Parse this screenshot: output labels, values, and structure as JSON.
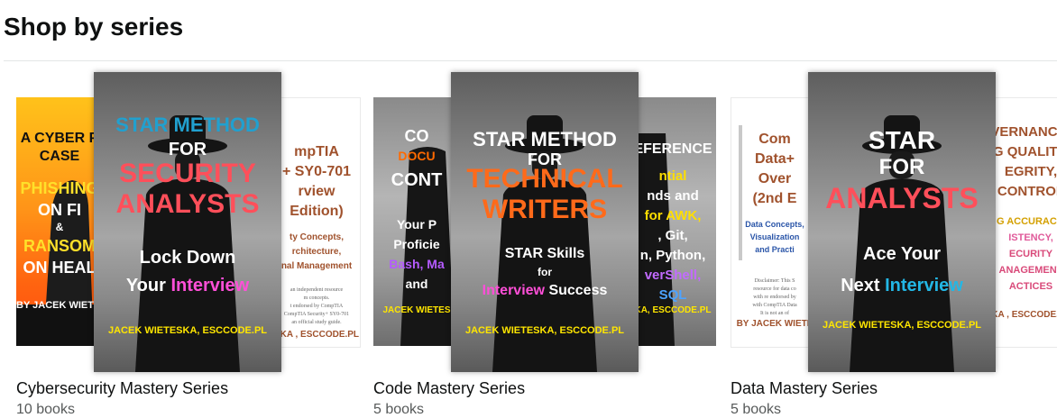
{
  "section": {
    "title": "Shop by series"
  },
  "series": [
    {
      "name": "Cybersecurity Mastery Series",
      "count": "10 books",
      "left_cover": {
        "lines": [
          "A CYBER P",
          "CASE",
          "PHISHING",
          "ON FI",
          "&",
          "RANSOM",
          "ON HEAL",
          "BY JACEK WIETES"
        ]
      },
      "center_cover": {
        "lines": [
          "STAR METHOD",
          "FOR",
          "SECURITY",
          "ANALYSTS",
          "Lock Down",
          "Your",
          "Interview",
          "JACEK WIETESKA, ESCCODE.PL"
        ]
      },
      "right_cover": {
        "lines": [
          "mpTIA",
          "+ SY0-701",
          "rview",
          "Edition)",
          "ty Concepts,",
          "rchitecture,",
          "nal Management",
          "an independent resource",
          "m concepts.",
          "t endorsed by CompTIA",
          "CompTIA Security+ SY0-701",
          "an official study guide.",
          "SKA , ESCCODE.PL"
        ]
      }
    },
    {
      "name": "Code Mastery Series",
      "count": "5 books",
      "left_cover": {
        "lines": [
          "CO",
          "DOCU",
          "CONT",
          "Your P",
          "Proficie",
          "Bash, Ma",
          "and",
          "JACEK WIETES"
        ]
      },
      "center_cover": {
        "lines": [
          "STAR METHOD",
          "FOR",
          "TECHNICAL",
          "WRITERS",
          "STAR Skills",
          "for",
          "Interview",
          "Success",
          "JACEK WIETESKA, ESCCODE.PL"
        ]
      },
      "right_cover": {
        "lines": [
          "EFERENCE",
          "ntial",
          "nds and",
          "for AWK,",
          ", Git,",
          "n, Python,",
          "verShell,",
          "SQL",
          "KA, ESCCODE.PL"
        ]
      }
    },
    {
      "name": "Data Mastery Series",
      "count": "5 books",
      "left_cover": {
        "lines": [
          "Com",
          "Data+",
          "Over",
          "(2nd E",
          "Data Concepts,",
          "Visualization",
          "and Practi",
          "Disclaimer: This S",
          "resource for data co",
          "with re endorsed by",
          "with CompTIA Data",
          "It is not an of",
          "BY JACEK WIETE"
        ]
      },
      "center_cover": {
        "lines": [
          "STAR",
          "FOR",
          "ANALYSTS",
          "Ace Your",
          "Next",
          "Interview",
          "JACEK WIETESKA, ESCCODE.PL"
        ]
      },
      "right_cover": {
        "lines": [
          "VERNANCE:",
          "G QUALITY,",
          "EGRITY,",
          "CONTROL",
          "G ACCURACY,",
          "ISTENCY,",
          "ECURITY",
          "ANAGEMENT",
          "ACTICES",
          "KA , ESCCODE.PL"
        ]
      }
    }
  ]
}
